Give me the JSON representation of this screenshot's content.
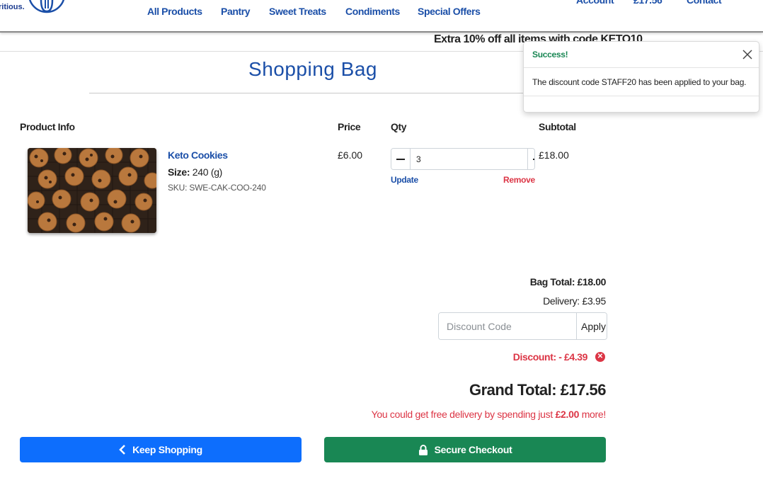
{
  "header": {
    "tagline": "ritious.",
    "nav": [
      "All Products",
      "Pantry",
      "Sweet Treats",
      "Condiments",
      "Special Offers"
    ],
    "account": "Account",
    "bag_total": "£17.56",
    "contact": "Contact"
  },
  "promo": "Extra 10% off all items with code KETO10",
  "page_title": "Shopping Bag",
  "table": {
    "headers": [
      "Product Info",
      "Price",
      "Qty",
      "Subtotal"
    ]
  },
  "item": {
    "name": "Keto Cookies",
    "size_label": "Size:",
    "size_value": "240 (g)",
    "sku": "SKU: SWE-CAK-COO-240",
    "price": "£6.00",
    "qty": "3",
    "subtotal": "£18.00",
    "update_label": "Update",
    "remove_label": "Remove"
  },
  "totals": {
    "bag_total": "Bag Total: £18.00",
    "delivery": "Delivery: £3.95",
    "discount_placeholder": "Discount Code",
    "apply_label": "Apply",
    "discount": "Discount: - £4.39",
    "grand_total": "Grand Total: £17.56",
    "free_delivery_prefix": "You could get free delivery by spending just ",
    "free_delivery_amount": "£2.00",
    "free_delivery_suffix": " more!"
  },
  "buttons": {
    "keep_shopping": "Keep Shopping",
    "checkout": "Secure Checkout"
  },
  "toast": {
    "title": "Success!",
    "message": "The discount code STAFF20 has been applied to your bag."
  },
  "colors": {
    "brand_blue": "#1b4fa8",
    "primary": "#0d6efd",
    "success": "#198754",
    "danger": "#dc3545"
  }
}
